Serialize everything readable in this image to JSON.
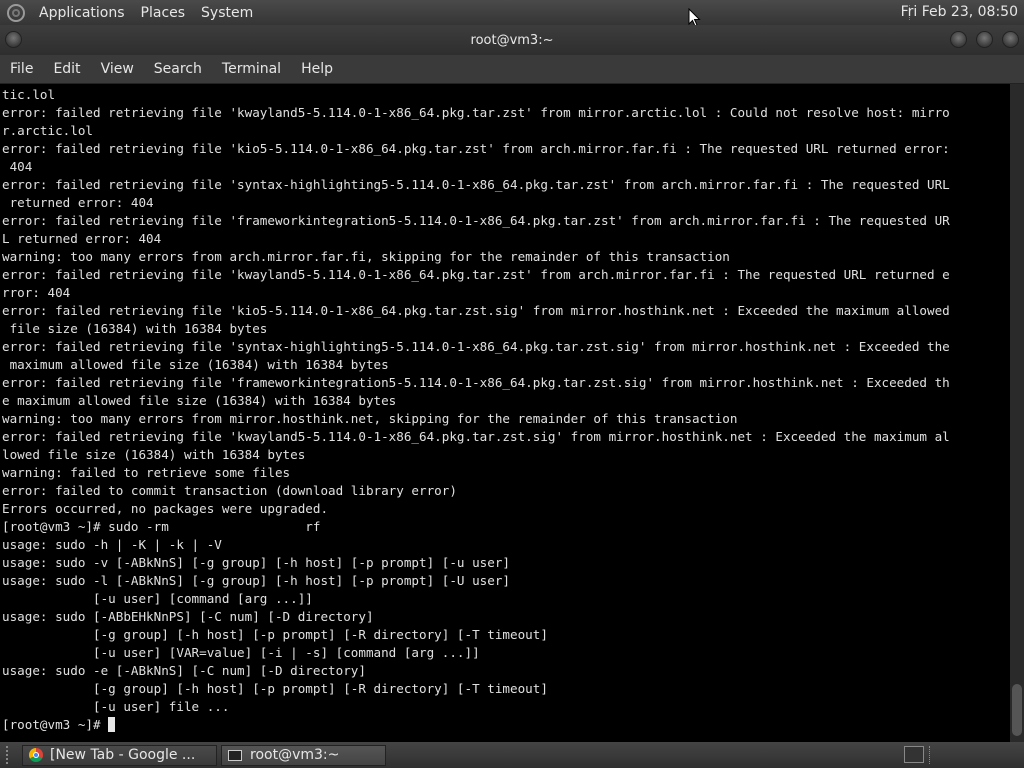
{
  "top_panel": {
    "menus": [
      "Applications",
      "Places",
      "System"
    ],
    "clock": "Fri Feb 23, 08:50"
  },
  "window": {
    "title": "root@vm3:~",
    "menu": [
      "File",
      "Edit",
      "View",
      "Search",
      "Terminal",
      "Help"
    ]
  },
  "terminal": {
    "lines": [
      "tic.lol",
      "error: failed retrieving file 'kwayland5-5.114.0-1-x86_64.pkg.tar.zst' from mirror.arctic.lol : Could not resolve host: mirro",
      "r.arctic.lol",
      "error: failed retrieving file 'kio5-5.114.0-1-x86_64.pkg.tar.zst' from arch.mirror.far.fi : The requested URL returned error:",
      " 404",
      "error: failed retrieving file 'syntax-highlighting5-5.114.0-1-x86_64.pkg.tar.zst' from arch.mirror.far.fi : The requested URL",
      " returned error: 404",
      "error: failed retrieving file 'frameworkintegration5-5.114.0-1-x86_64.pkg.tar.zst' from arch.mirror.far.fi : The requested UR",
      "L returned error: 404",
      "warning: too many errors from arch.mirror.far.fi, skipping for the remainder of this transaction",
      "error: failed retrieving file 'kwayland5-5.114.0-1-x86_64.pkg.tar.zst' from arch.mirror.far.fi : The requested URL returned e",
      "rror: 404",
      "error: failed retrieving file 'kio5-5.114.0-1-x86_64.pkg.tar.zst.sig' from mirror.hosthink.net : Exceeded the maximum allowed",
      " file size (16384) with 16384 bytes",
      "error: failed retrieving file 'syntax-highlighting5-5.114.0-1-x86_64.pkg.tar.zst.sig' from mirror.hosthink.net : Exceeded the",
      " maximum allowed file size (16384) with 16384 bytes",
      "error: failed retrieving file 'frameworkintegration5-5.114.0-1-x86_64.pkg.tar.zst.sig' from mirror.hosthink.net : Exceeded th",
      "e maximum allowed file size (16384) with 16384 bytes",
      "warning: too many errors from mirror.hosthink.net, skipping for the remainder of this transaction",
      "error: failed retrieving file 'kwayland5-5.114.0-1-x86_64.pkg.tar.zst.sig' from mirror.hosthink.net : Exceeded the maximum al",
      "lowed file size (16384) with 16384 bytes",
      "warning: failed to retrieve some files",
      "error: failed to commit transaction (download library error)",
      "Errors occurred, no packages were upgraded.",
      "[root@vm3 ~]# sudo -rm                  rf",
      "usage: sudo -h | -K | -k | -V",
      "usage: sudo -v [-ABkNnS] [-g group] [-h host] [-p prompt] [-u user]",
      "usage: sudo -l [-ABkNnS] [-g group] [-h host] [-p prompt] [-U user]",
      "            [-u user] [command [arg ...]]",
      "usage: sudo [-ABbEHkNnPS] [-C num] [-D directory]",
      "            [-g group] [-h host] [-p prompt] [-R directory] [-T timeout]",
      "            [-u user] [VAR=value] [-i | -s] [command [arg ...]]",
      "usage: sudo -e [-ABkNnS] [-C num] [-D directory]",
      "            [-g group] [-h host] [-p prompt] [-R directory] [-T timeout]",
      "            [-u user] file ..."
    ],
    "prompt": "[root@vm3 ~]# "
  },
  "taskbar": {
    "tasks": [
      "[New Tab - Google ...",
      "root@vm3:~"
    ]
  }
}
